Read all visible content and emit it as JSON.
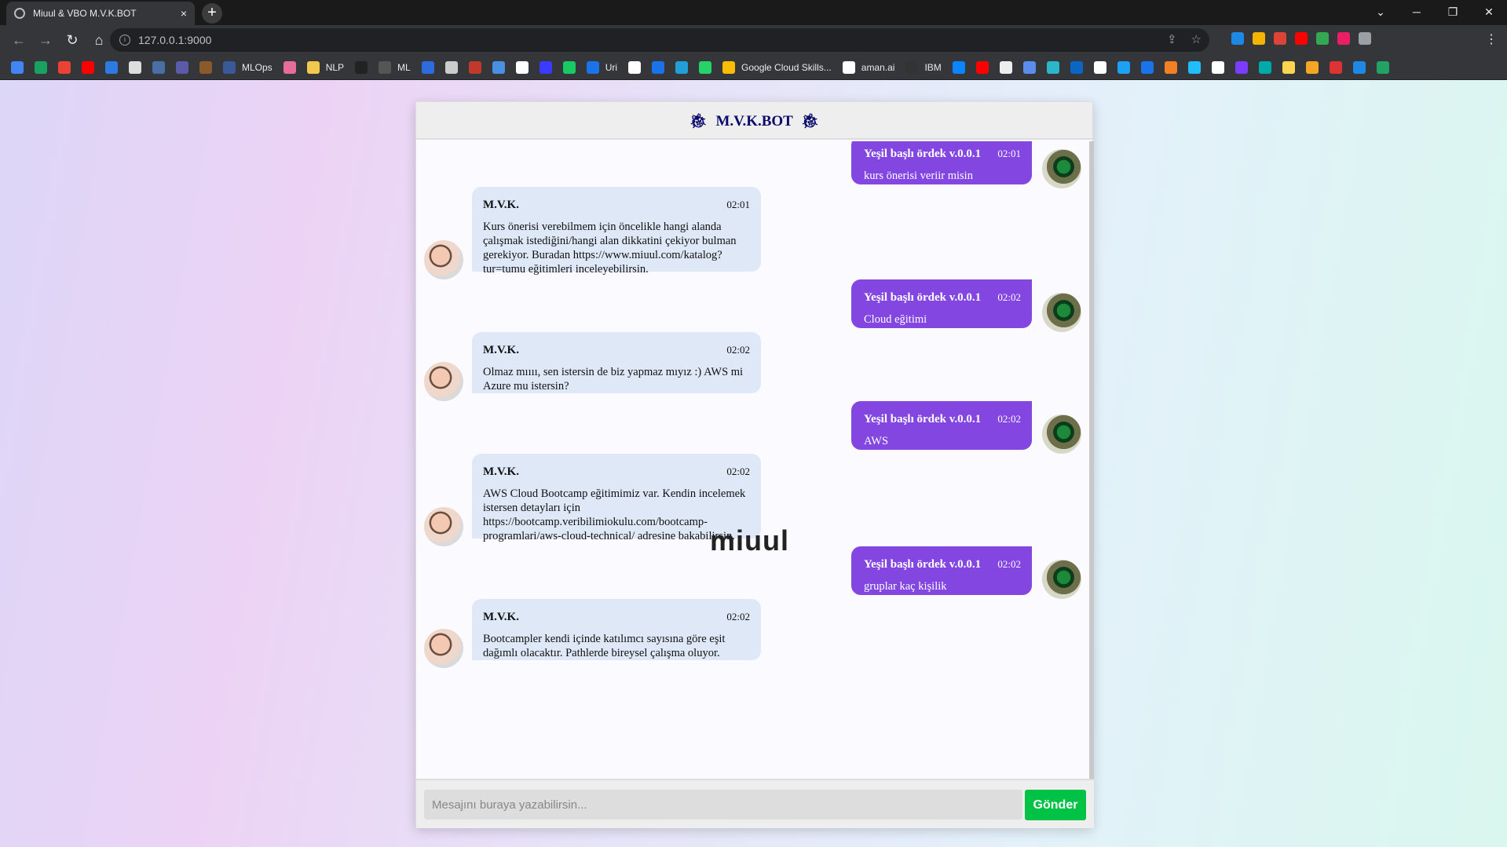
{
  "browser": {
    "tab_title": "Miuul & VBO M.V.K.BOT",
    "tab_close": "×",
    "new_tab": "+",
    "url": "127.0.0.1:9000",
    "bookmarks": [
      {
        "label": "",
        "color": "#4285f4"
      },
      {
        "label": "",
        "color": "#1aa260"
      },
      {
        "label": "",
        "color": "#ea4335"
      },
      {
        "label": "",
        "color": "#ff0000"
      },
      {
        "label": "",
        "color": "#2d7be0"
      },
      {
        "label": "",
        "color": "#dddddd"
      },
      {
        "label": "",
        "color": "#4a6fa5"
      },
      {
        "label": "",
        "color": "#5a5aa8"
      },
      {
        "label": "",
        "color": "#8b5a2b"
      },
      {
        "label": "MLOps",
        "color": "#3b5998"
      },
      {
        "label": "",
        "color": "#e86c9a"
      },
      {
        "label": "NLP",
        "color": "#f2c94c"
      },
      {
        "label": "",
        "color": "#222222"
      },
      {
        "label": "ML",
        "color": "#555555"
      },
      {
        "label": "",
        "color": "#2d6cdf"
      },
      {
        "label": "",
        "color": "#cccccc"
      },
      {
        "label": "",
        "color": "#c0392b"
      },
      {
        "label": "",
        "color": "#4a90e2"
      },
      {
        "label": "",
        "color": "#ffffff"
      },
      {
        "label": "",
        "color": "#3b3bff"
      },
      {
        "label": "",
        "color": "#18c964"
      },
      {
        "label": "Uri",
        "color": "#1a73e8"
      },
      {
        "label": "",
        "color": "#ffffff"
      },
      {
        "label": "",
        "color": "#1a73e8"
      },
      {
        "label": "",
        "color": "#229ed9"
      },
      {
        "label": "",
        "color": "#25d366"
      },
      {
        "label": "Google Cloud Skills...",
        "color": "#fbbc05"
      },
      {
        "label": "aman.ai",
        "color": "#ffffff"
      },
      {
        "label": "IBM",
        "color": "#333333"
      },
      {
        "label": "",
        "color": "#0a84ff"
      },
      {
        "label": "",
        "color": "#ff0000"
      },
      {
        "label": "",
        "color": "#eeeeee"
      },
      {
        "label": "",
        "color": "#5b8def"
      },
      {
        "label": "",
        "color": "#2ab7ca"
      },
      {
        "label": "",
        "color": "#0a66c2"
      },
      {
        "label": "",
        "color": "#ffffff"
      },
      {
        "label": "",
        "color": "#1da1f2"
      },
      {
        "label": "",
        "color": "#1a73e8"
      },
      {
        "label": "",
        "color": "#f48024"
      },
      {
        "label": "",
        "color": "#20beff"
      },
      {
        "label": "",
        "color": "#ffffff"
      },
      {
        "label": "",
        "color": "#7a3cff"
      },
      {
        "label": "",
        "color": "#0aa"
      },
      {
        "label": "",
        "color": "#ffd54f"
      },
      {
        "label": "",
        "color": "#f5a623"
      },
      {
        "label": "",
        "color": "#d33"
      },
      {
        "label": "",
        "color": "#1e88e5"
      },
      {
        "label": "",
        "color": "#21a366"
      }
    ],
    "extensions": [
      "#1e88e5",
      "#f4b400",
      "#db4437",
      "#ff0000",
      "#34a853",
      "#e91e63",
      "#9aa0a6"
    ]
  },
  "chat": {
    "title": "M.V.K.BOT",
    "header_icon": "bug-icon",
    "watermark": "miuul",
    "input_placeholder": "Mesajını buraya yazabilirsin...",
    "send_label": "Gönder",
    "messages": [
      {
        "side": "right",
        "name": "Yeşil başlı ördek v.0.0.1",
        "time": "02:01",
        "text": "kurs önerisi veriir misin"
      },
      {
        "side": "left",
        "name": "M.V.K.",
        "time": "02:01",
        "text": "Kurs önerisi verebilmem için öncelikle hangi alanda çalışmak istediğini/hangi alan dikkatini çekiyor bulman gerekiyor. Buradan https://www.miuul.com/katalog?tur=tumu eğitimleri inceleyebilirsin."
      },
      {
        "side": "right",
        "name": "Yeşil başlı ördek v.0.0.1",
        "time": "02:02",
        "text": "Cloud eğitimi"
      },
      {
        "side": "left",
        "name": "M.V.K.",
        "time": "02:02",
        "text": "Olmaz mıııı, sen istersin de biz yapmaz mıyız :) AWS mi Azure mu istersin?"
      },
      {
        "side": "right",
        "name": "Yeşil başlı ördek v.0.0.1",
        "time": "02:02",
        "text": "AWS"
      },
      {
        "side": "left",
        "name": "M.V.K.",
        "time": "02:02",
        "text": "AWS Cloud Bootcamp eğitimimiz var. Kendin incelemek istersen detayları için https://bootcamp.veribilimiokulu.com/bootcamp-programlari/aws-cloud-technical/ adresine bakabilirsin."
      },
      {
        "side": "right",
        "name": "Yeşil başlı ördek v.0.0.1",
        "time": "02:02",
        "text": "gruplar kaç kişilik"
      },
      {
        "side": "left",
        "name": "M.V.K.",
        "time": "02:02",
        "text": "Bootcampler kendi içinde katılımcı sayısına göre eşit dağımlı olacaktır. Pathlerde bireysel çalışma oluyor."
      }
    ]
  }
}
